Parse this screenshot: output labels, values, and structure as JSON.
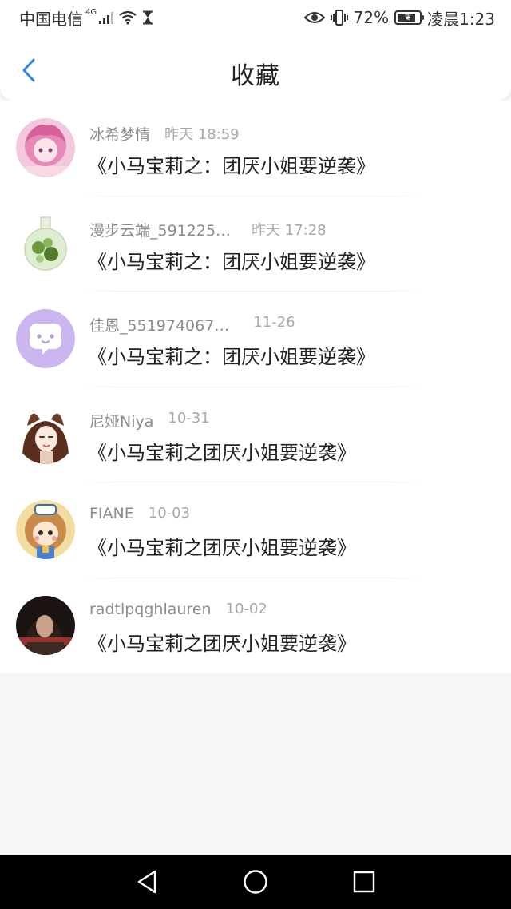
{
  "status_bar": {
    "carrier": "中国电信",
    "network_type": "4G",
    "battery_percent": "72%",
    "battery_level": 0.72,
    "time": "凌晨1:23",
    "icons": [
      "signal-icon",
      "wifi-icon",
      "hourglass-icon",
      "eye-icon",
      "vibrate-icon",
      "battery-icon"
    ]
  },
  "header": {
    "title": "收藏",
    "back_icon": "chevron-left-icon",
    "accent_color": "#2b8ae6"
  },
  "favorites": [
    {
      "name": "冰希梦情",
      "time": "昨天 18:59",
      "title": "《小马宝莉之：团厌小姐要逆袭》",
      "avatar": "pink-anime-girl-avatar"
    },
    {
      "name": "漫步云端_591225…",
      "time": "昨天 17:28",
      "title": "《小马宝莉之：团厌小姐要逆袭》",
      "avatar": "glass-bottle-plant-avatar"
    },
    {
      "name": "佳恩_551974067…",
      "time": "11-26",
      "title": "《小马宝莉之：团厌小姐要逆袭》",
      "avatar": "chat-bubble-avatar"
    },
    {
      "name": "尼娅Niya",
      "time": "10-31",
      "title": "《小马宝莉之团厌小姐要逆袭》",
      "avatar": "bunny-girl-avatar"
    },
    {
      "name": "FIANE",
      "time": "10-03",
      "title": "《小马宝莉之团厌小姐要逆袭》",
      "avatar": "cartoon-chef-girl-avatar"
    },
    {
      "name": "radtlpqghlauren",
      "time": "10-02",
      "title": "《小马宝莉之团厌小姐要逆袭》",
      "avatar": "dark-photo-avatar"
    }
  ],
  "system_nav": {
    "icons": [
      "back-triangle-icon",
      "home-circle-icon",
      "recents-square-icon"
    ]
  }
}
